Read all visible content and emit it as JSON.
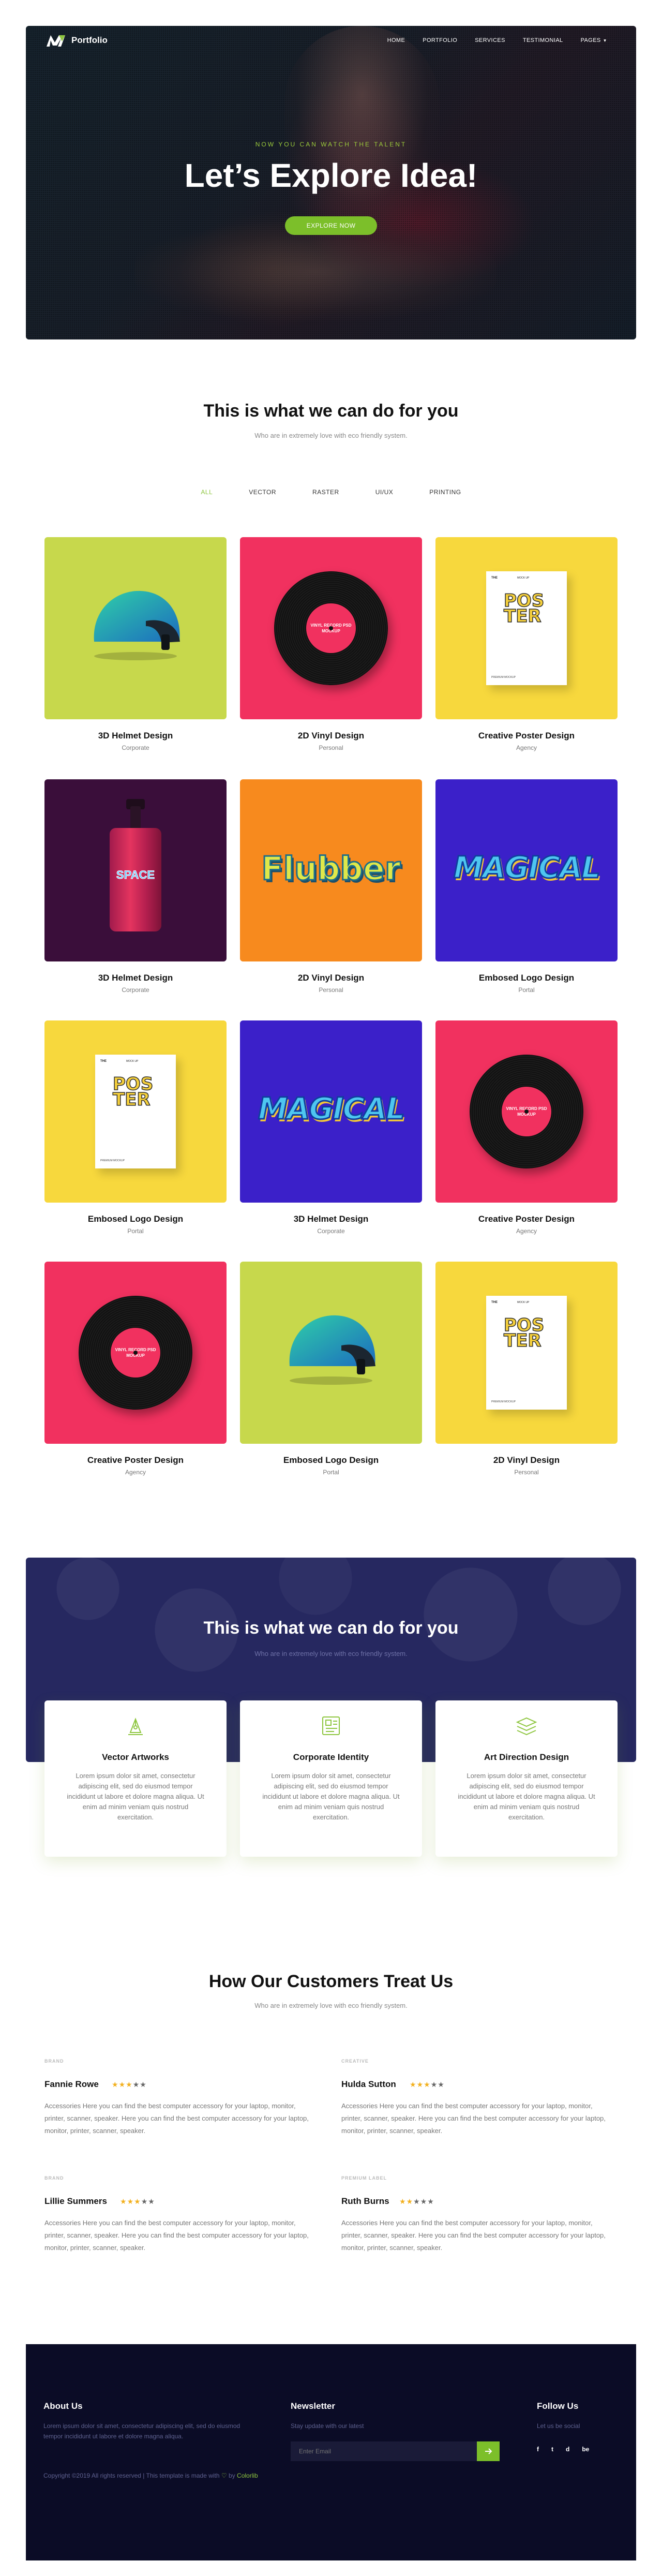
{
  "nav": {
    "brand": "Portfolio",
    "menu": [
      {
        "label": "HOME"
      },
      {
        "label": "PORTFOLIO"
      },
      {
        "label": "SERVICES"
      },
      {
        "label": "TESTIMONIAL"
      },
      {
        "label": "PAGES"
      }
    ]
  },
  "hero": {
    "subtitle": "NOW YOU CAN WATCH THE TALENT",
    "title": "Let’s Explore Idea!",
    "button": "EXPLORE NOW"
  },
  "portfolio": {
    "title": "This is what we can do for you",
    "subtitle": "Who are in extremely love with eco friendly system.",
    "filters": [
      "ALL",
      "VECTOR",
      "RASTER",
      "UI/UX",
      "PRINTING"
    ],
    "active_filter": "ALL",
    "items": [
      {
        "title": "3D Helmet Design",
        "category": "Corporate",
        "art": "helmet",
        "bg": "#c7d84c"
      },
      {
        "title": "2D Vinyl Design",
        "category": "Personal",
        "art": "vinyl",
        "bg": "#f1315f"
      },
      {
        "title": "Creative Poster Design",
        "category": "Agency",
        "art": "poster",
        "bg": "#f7d83d"
      },
      {
        "title": "3D Helmet Design",
        "category": "Corporate",
        "art": "bottle",
        "bg": "#3a0e3a"
      },
      {
        "title": "2D Vinyl Design",
        "category": "Personal",
        "art": "flubber",
        "bg": "#f78a1e"
      },
      {
        "title": "Embosed Logo Design",
        "category": "Portal",
        "art": "magical",
        "bg": "#3b20c9"
      },
      {
        "title": "Embosed Logo Design",
        "category": "Portal",
        "art": "poster",
        "bg": "#f7d83d"
      },
      {
        "title": "3D Helmet Design",
        "category": "Corporate",
        "art": "magical",
        "bg": "#3b20c9"
      },
      {
        "title": "Creative Poster Design",
        "category": "Agency",
        "art": "vinyl",
        "bg": "#f1315f"
      },
      {
        "title": "Creative Poster Design",
        "category": "Agency",
        "art": "vinyl",
        "bg": "#f1315f"
      },
      {
        "title": "Embosed Logo Design",
        "category": "Portal",
        "art": "helmet",
        "bg": "#c7d84c"
      },
      {
        "title": "2D Vinyl Design",
        "category": "Personal",
        "art": "poster",
        "bg": "#f7d83d"
      }
    ],
    "art_text": {
      "vinyl_label": "VINYL RECORD PSD MOCKUP",
      "poster_word": "POSTER",
      "poster_head": "THE",
      "poster_head2": "MOCK UP",
      "poster_foot": "PREMIUM MOCKUP",
      "bottle_word": "SPACE",
      "flubber_word": "Flubber",
      "magical_word": "MAGICAL"
    }
  },
  "services": {
    "title": "This is what we can do for you",
    "subtitle": "Who are in extremely love with eco friendly system.",
    "items": [
      {
        "title": "Vector Artworks",
        "icon": "pen-tool-icon",
        "desc": "Lorem ipsum dolor sit amet, consectetur adipiscing elit, sed do eiusmod tempor incididunt ut labore et dolore magna aliqua. Ut enim ad minim veniam quis nostrud exercitation."
      },
      {
        "title": "Corporate Identity",
        "icon": "id-card-icon",
        "desc": "Lorem ipsum dolor sit amet, consectetur adipiscing elit, sed do eiusmod tempor incididunt ut labore et dolore magna aliqua. Ut enim ad minim veniam quis nostrud exercitation."
      },
      {
        "title": "Art Direction Design",
        "icon": "layers-icon",
        "desc": "Lorem ipsum dolor sit amet, consectetur adipiscing elit, sed do eiusmod tempor incididunt ut labore et dolore magna aliqua. Ut enim ad minim veniam quis nostrud exercitation."
      }
    ],
    "accent": "#8ec63f"
  },
  "testimonials": {
    "title": "How Our Customers Treat Us",
    "subtitle": "Who are in extremely love with eco friendly system.",
    "items": [
      {
        "name": "Fannie Rowe",
        "rating": 3,
        "brand": "BRAND",
        "quote": "Accessories Here you can find the best computer accessory for your laptop, monitor, printer, scanner, speaker. Here you can find the best computer accessory for your laptop, monitor, printer, scanner, speaker."
      },
      {
        "name": "Hulda Sutton",
        "rating": 3,
        "brand": "CREATIVE",
        "quote": "Accessories Here you can find the best computer accessory for your laptop, monitor, printer, scanner, speaker. Here you can find the best computer accessory for your laptop, monitor, printer, scanner, speaker."
      },
      {
        "name": "Lillie Summers",
        "rating": 3,
        "brand": "BRAND",
        "quote": "Accessories Here you can find the best computer accessory for your laptop, monitor, printer, scanner, speaker. Here you can find the best computer accessory for your laptop, monitor, printer, scanner, speaker."
      },
      {
        "name": "Ruth Burns",
        "rating": 2,
        "brand": "PREMIUM LABEL",
        "quote": "Accessories Here you can find the best computer accessory for your laptop, monitor, printer, scanner, speaker. Here you can find the best computer accessory for your laptop, monitor, printer, scanner, speaker."
      }
    ]
  },
  "footer": {
    "about_title": "About Us",
    "about_text": "Lorem ipsum dolor sit amet, consectetur adipiscing elit, sed do eiusmod tempor incididunt ut labore et dolore magna aliqua.",
    "copyright_pre": "Copyright ©2019 All rights reserved | This template is made with",
    "copyright_by": "by",
    "copyright_link": "Colorlib",
    "newsletter_title": "Newsletter",
    "newsletter_text": "Stay update with our latest",
    "email_placeholder": "Enter Email",
    "follow_title": "Follow Us",
    "follow_text": "Let us be social",
    "socials": [
      "f",
      "t",
      "d",
      "be"
    ]
  }
}
